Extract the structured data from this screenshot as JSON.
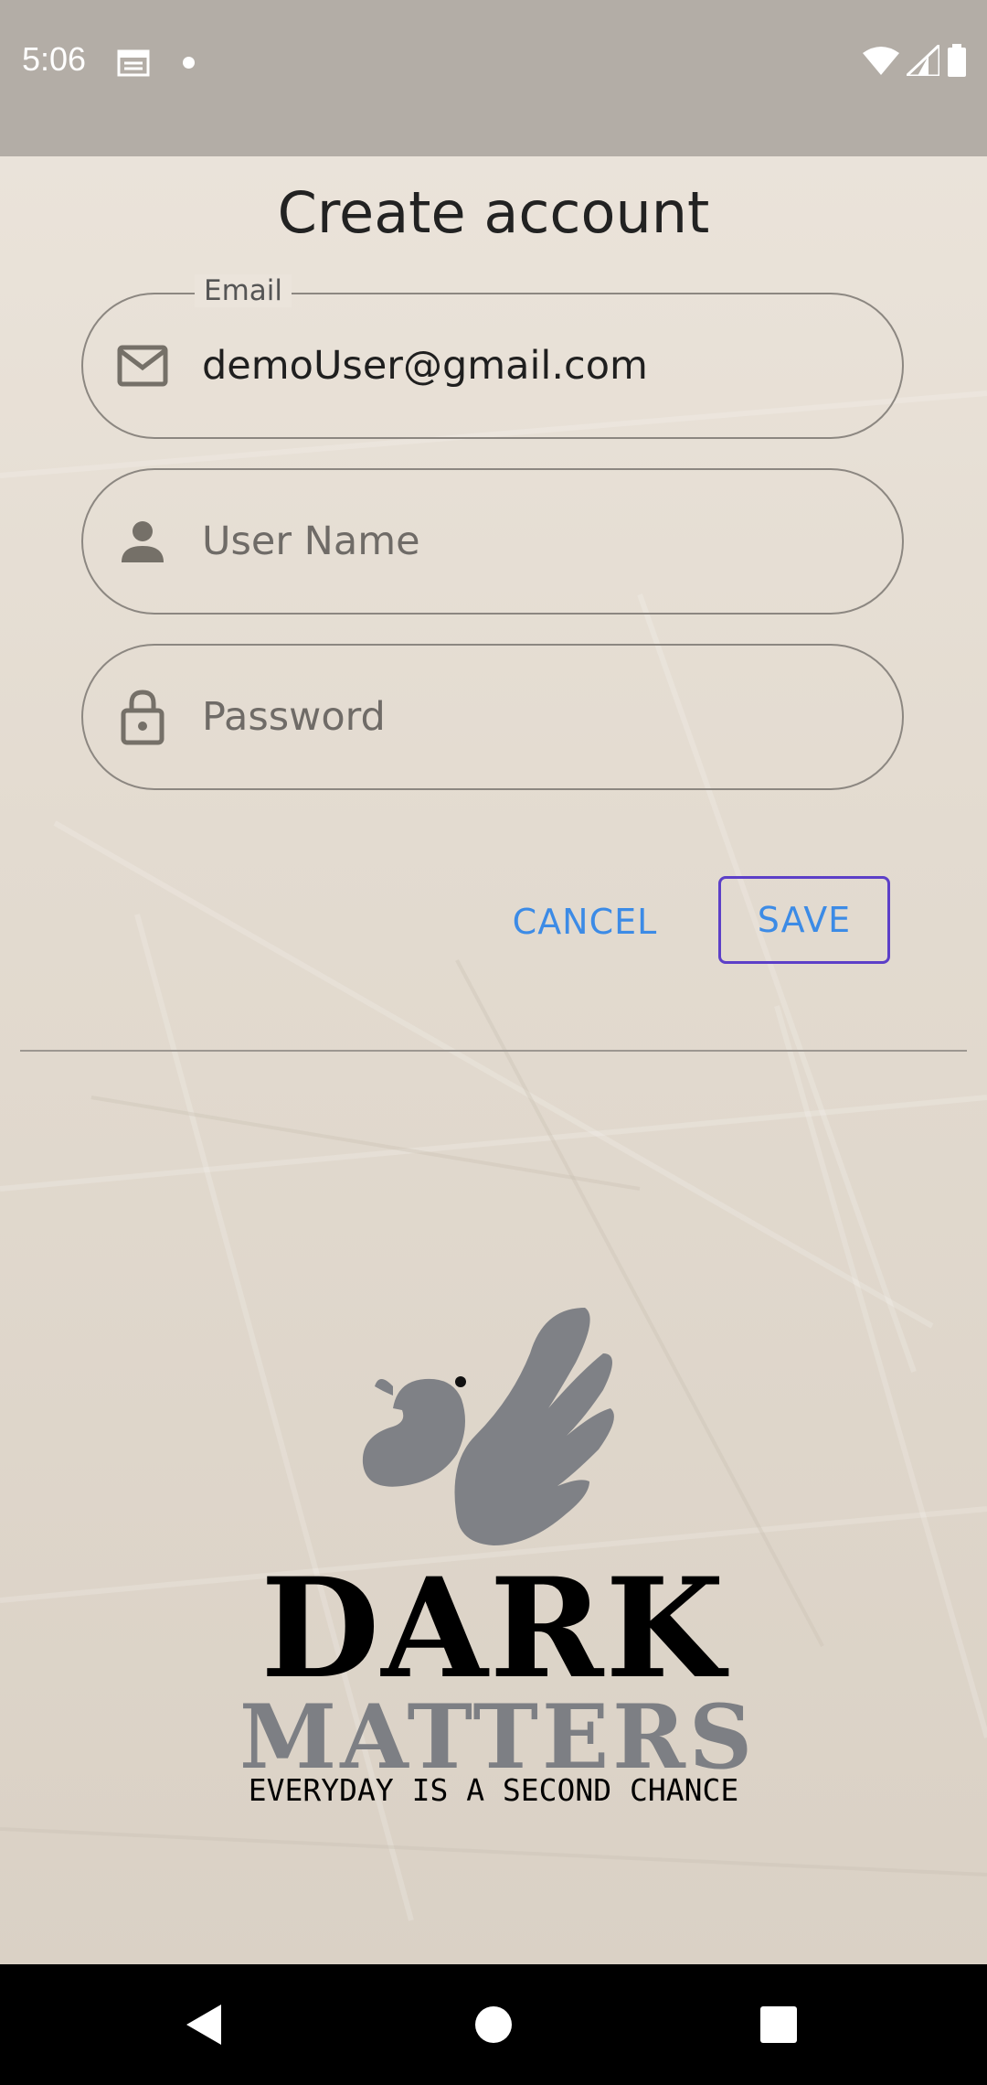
{
  "status_bar": {
    "time": "5:06"
  },
  "page": {
    "title": "Create account"
  },
  "form": {
    "email": {
      "label": "Email",
      "value": "demoUser@gmail.com",
      "icon": "mail-icon"
    },
    "username": {
      "placeholder": "User Name",
      "icon": "person-icon"
    },
    "password": {
      "placeholder": "Password",
      "icon": "lock-icon"
    }
  },
  "actions": {
    "cancel_label": "CANCEL",
    "save_label": "SAVE"
  },
  "logo": {
    "line1": "DARK",
    "line2": "MATTERS",
    "tagline": "EVERYDAY IS A SECOND CHANCE"
  },
  "colors": {
    "accent": "#3c8be6",
    "save_border": "#5c3fc8",
    "logo_gray": "#7d7f84"
  },
  "nav_bar": {
    "icons": [
      "back-icon",
      "home-icon",
      "recents-icon"
    ]
  }
}
